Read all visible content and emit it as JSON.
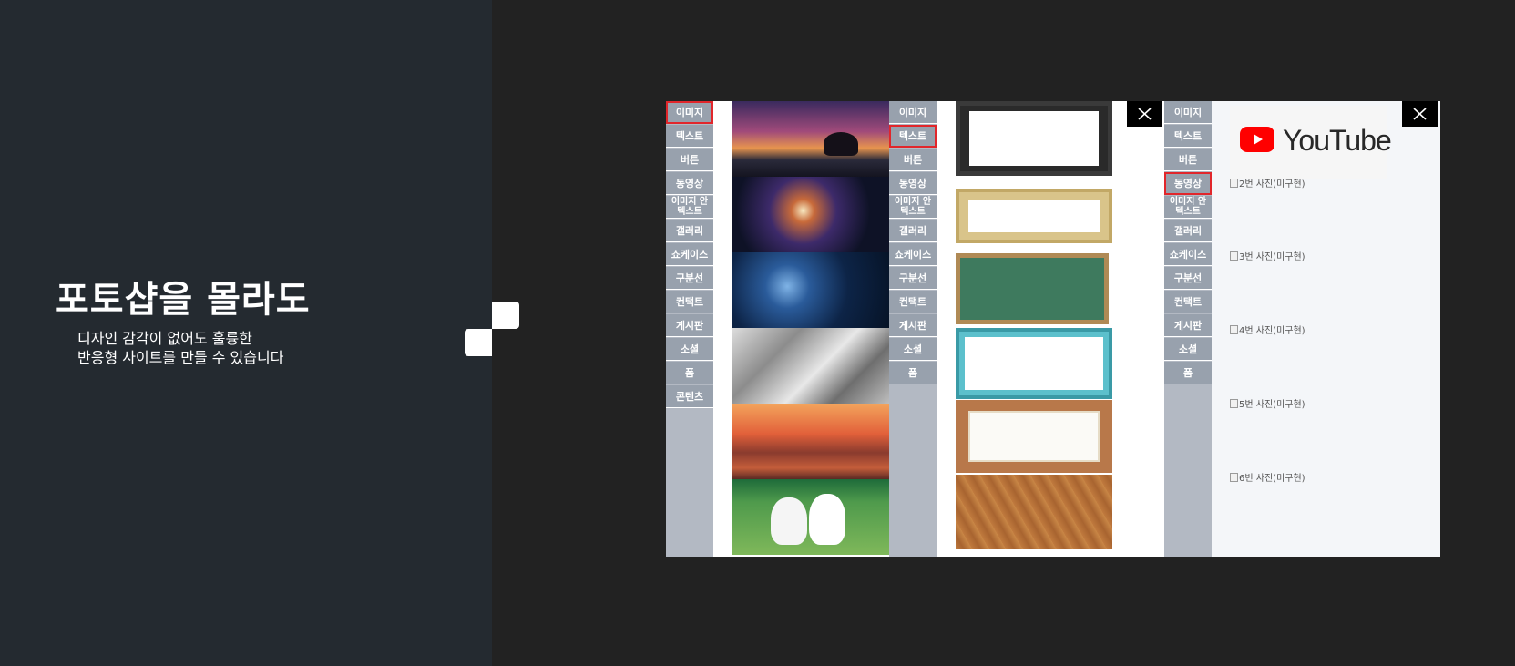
{
  "hero": {
    "title": "포토샵을 몰라도",
    "subtitle_line1": "디자인 감각이 없어도 훌륭한",
    "subtitle_line2": "반응형 사이트를 만들 수 있습니다"
  },
  "menu": [
    {
      "label": "이미지"
    },
    {
      "label": "텍스트"
    },
    {
      "label": "버튼"
    },
    {
      "label": "동영상"
    },
    {
      "label": "이미지 안 텍스트"
    },
    {
      "label": "갤러리"
    },
    {
      "label": "쇼케이스"
    },
    {
      "label": "구분선"
    },
    {
      "label": "컨택트"
    },
    {
      "label": "게시판"
    },
    {
      "label": "소셜"
    },
    {
      "label": "폼"
    },
    {
      "label": "콘텐츠"
    }
  ],
  "panels": [
    {
      "selected": "이미지"
    },
    {
      "selected": "텍스트"
    },
    {
      "selected": "동영상"
    }
  ],
  "video": {
    "logo_text": "YouTube",
    "broken_images": [
      "2번 사진(미구현)",
      "3번 사진(미구현)",
      "4번 사진(미구현)",
      "5번 사진(미구현)",
      "6번 사진(미구현)"
    ]
  },
  "colors": {
    "left_bg": "#242a30",
    "right_bg": "#222222",
    "active_outline": "#e1262b",
    "sidebar_item": "#98a1ad"
  }
}
